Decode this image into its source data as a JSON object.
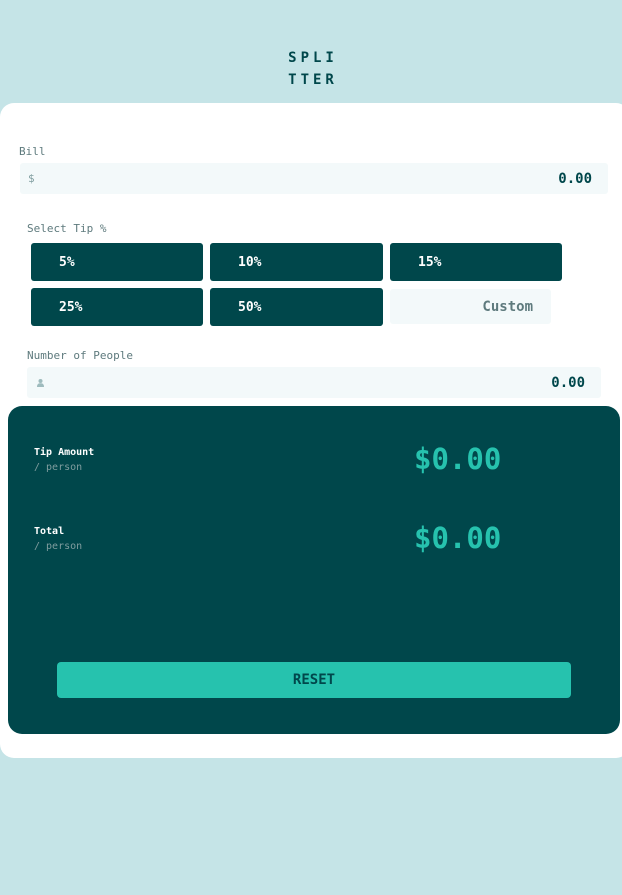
{
  "logo": {
    "line1": "SPLI",
    "line2": "TTER"
  },
  "bill": {
    "label": "Bill",
    "prefix": "$",
    "value": "0.00"
  },
  "tip": {
    "label": "Select Tip %",
    "options": [
      "5%",
      "10%",
      "15%",
      "25%",
      "50%"
    ],
    "custom_placeholder": "Custom"
  },
  "people": {
    "label": "Number of People",
    "value": "0.00",
    "icon": "person-icon"
  },
  "results": {
    "tip_amount": {
      "label": "Tip Amount",
      "sub": "/ person",
      "value": "$0.00"
    },
    "total": {
      "label": "Total",
      "sub": "/ person",
      "value": "$0.00"
    },
    "reset_label": "RESET"
  },
  "colors": {
    "background": "#c5e4e7",
    "dark_cyan": "#00474b",
    "strong_cyan": "#26c2ae",
    "input_bg": "#f3f9fa",
    "label_gray": "#5e7a7d"
  }
}
